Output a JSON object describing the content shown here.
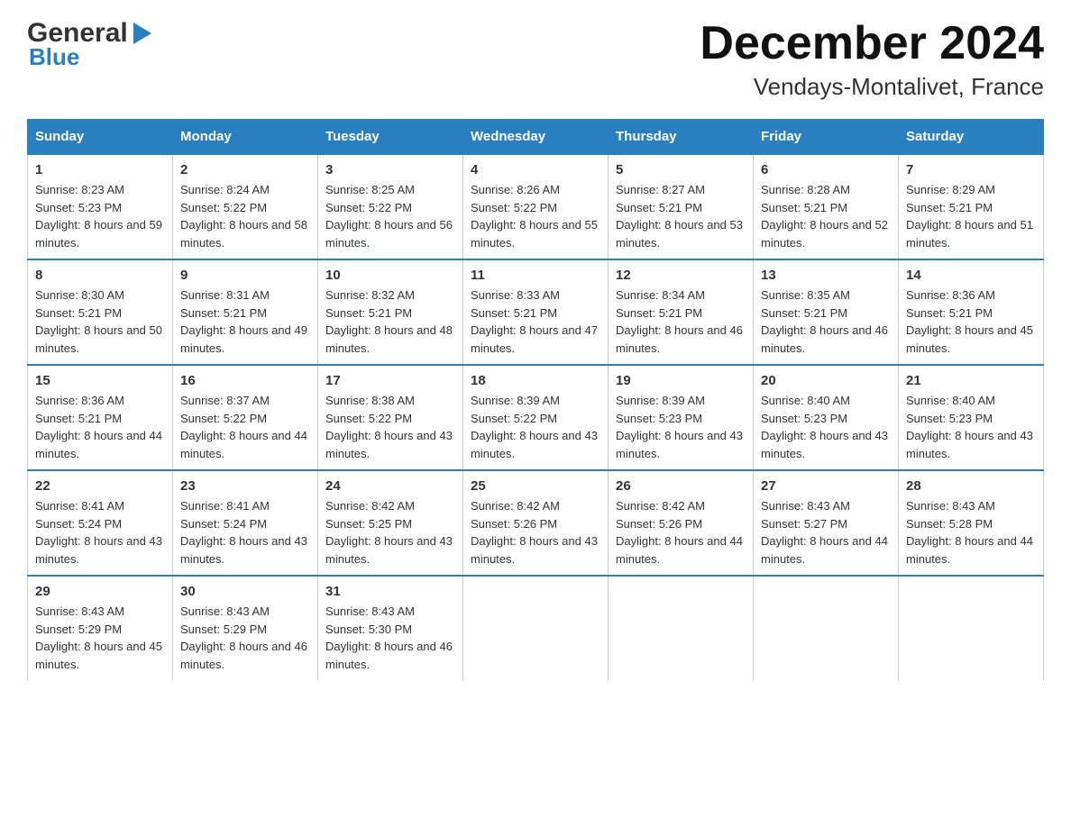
{
  "logo": {
    "general": "General",
    "arrow": "▶",
    "blue": "Blue"
  },
  "title": "December 2024",
  "subtitle": "Vendays-Montalivet, France",
  "days_header": [
    "Sunday",
    "Monday",
    "Tuesday",
    "Wednesday",
    "Thursday",
    "Friday",
    "Saturday"
  ],
  "weeks": [
    [
      {
        "day": "1",
        "sunrise": "8:23 AM",
        "sunset": "5:23 PM",
        "daylight": "8 hours and 59 minutes."
      },
      {
        "day": "2",
        "sunrise": "8:24 AM",
        "sunset": "5:22 PM",
        "daylight": "8 hours and 58 minutes."
      },
      {
        "day": "3",
        "sunrise": "8:25 AM",
        "sunset": "5:22 PM",
        "daylight": "8 hours and 56 minutes."
      },
      {
        "day": "4",
        "sunrise": "8:26 AM",
        "sunset": "5:22 PM",
        "daylight": "8 hours and 55 minutes."
      },
      {
        "day": "5",
        "sunrise": "8:27 AM",
        "sunset": "5:21 PM",
        "daylight": "8 hours and 53 minutes."
      },
      {
        "day": "6",
        "sunrise": "8:28 AM",
        "sunset": "5:21 PM",
        "daylight": "8 hours and 52 minutes."
      },
      {
        "day": "7",
        "sunrise": "8:29 AM",
        "sunset": "5:21 PM",
        "daylight": "8 hours and 51 minutes."
      }
    ],
    [
      {
        "day": "8",
        "sunrise": "8:30 AM",
        "sunset": "5:21 PM",
        "daylight": "8 hours and 50 minutes."
      },
      {
        "day": "9",
        "sunrise": "8:31 AM",
        "sunset": "5:21 PM",
        "daylight": "8 hours and 49 minutes."
      },
      {
        "day": "10",
        "sunrise": "8:32 AM",
        "sunset": "5:21 PM",
        "daylight": "8 hours and 48 minutes."
      },
      {
        "day": "11",
        "sunrise": "8:33 AM",
        "sunset": "5:21 PM",
        "daylight": "8 hours and 47 minutes."
      },
      {
        "day": "12",
        "sunrise": "8:34 AM",
        "sunset": "5:21 PM",
        "daylight": "8 hours and 46 minutes."
      },
      {
        "day": "13",
        "sunrise": "8:35 AM",
        "sunset": "5:21 PM",
        "daylight": "8 hours and 46 minutes."
      },
      {
        "day": "14",
        "sunrise": "8:36 AM",
        "sunset": "5:21 PM",
        "daylight": "8 hours and 45 minutes."
      }
    ],
    [
      {
        "day": "15",
        "sunrise": "8:36 AM",
        "sunset": "5:21 PM",
        "daylight": "8 hours and 44 minutes."
      },
      {
        "day": "16",
        "sunrise": "8:37 AM",
        "sunset": "5:22 PM",
        "daylight": "8 hours and 44 minutes."
      },
      {
        "day": "17",
        "sunrise": "8:38 AM",
        "sunset": "5:22 PM",
        "daylight": "8 hours and 43 minutes."
      },
      {
        "day": "18",
        "sunrise": "8:39 AM",
        "sunset": "5:22 PM",
        "daylight": "8 hours and 43 minutes."
      },
      {
        "day": "19",
        "sunrise": "8:39 AM",
        "sunset": "5:23 PM",
        "daylight": "8 hours and 43 minutes."
      },
      {
        "day": "20",
        "sunrise": "8:40 AM",
        "sunset": "5:23 PM",
        "daylight": "8 hours and 43 minutes."
      },
      {
        "day": "21",
        "sunrise": "8:40 AM",
        "sunset": "5:23 PM",
        "daylight": "8 hours and 43 minutes."
      }
    ],
    [
      {
        "day": "22",
        "sunrise": "8:41 AM",
        "sunset": "5:24 PM",
        "daylight": "8 hours and 43 minutes."
      },
      {
        "day": "23",
        "sunrise": "8:41 AM",
        "sunset": "5:24 PM",
        "daylight": "8 hours and 43 minutes."
      },
      {
        "day": "24",
        "sunrise": "8:42 AM",
        "sunset": "5:25 PM",
        "daylight": "8 hours and 43 minutes."
      },
      {
        "day": "25",
        "sunrise": "8:42 AM",
        "sunset": "5:26 PM",
        "daylight": "8 hours and 43 minutes."
      },
      {
        "day": "26",
        "sunrise": "8:42 AM",
        "sunset": "5:26 PM",
        "daylight": "8 hours and 44 minutes."
      },
      {
        "day": "27",
        "sunrise": "8:43 AM",
        "sunset": "5:27 PM",
        "daylight": "8 hours and 44 minutes."
      },
      {
        "day": "28",
        "sunrise": "8:43 AM",
        "sunset": "5:28 PM",
        "daylight": "8 hours and 44 minutes."
      }
    ],
    [
      {
        "day": "29",
        "sunrise": "8:43 AM",
        "sunset": "5:29 PM",
        "daylight": "8 hours and 45 minutes."
      },
      {
        "day": "30",
        "sunrise": "8:43 AM",
        "sunset": "5:29 PM",
        "daylight": "8 hours and 46 minutes."
      },
      {
        "day": "31",
        "sunrise": "8:43 AM",
        "sunset": "5:30 PM",
        "daylight": "8 hours and 46 minutes."
      },
      {
        "day": "",
        "sunrise": "",
        "sunset": "",
        "daylight": ""
      },
      {
        "day": "",
        "sunrise": "",
        "sunset": "",
        "daylight": ""
      },
      {
        "day": "",
        "sunrise": "",
        "sunset": "",
        "daylight": ""
      },
      {
        "day": "",
        "sunrise": "",
        "sunset": "",
        "daylight": ""
      }
    ]
  ]
}
